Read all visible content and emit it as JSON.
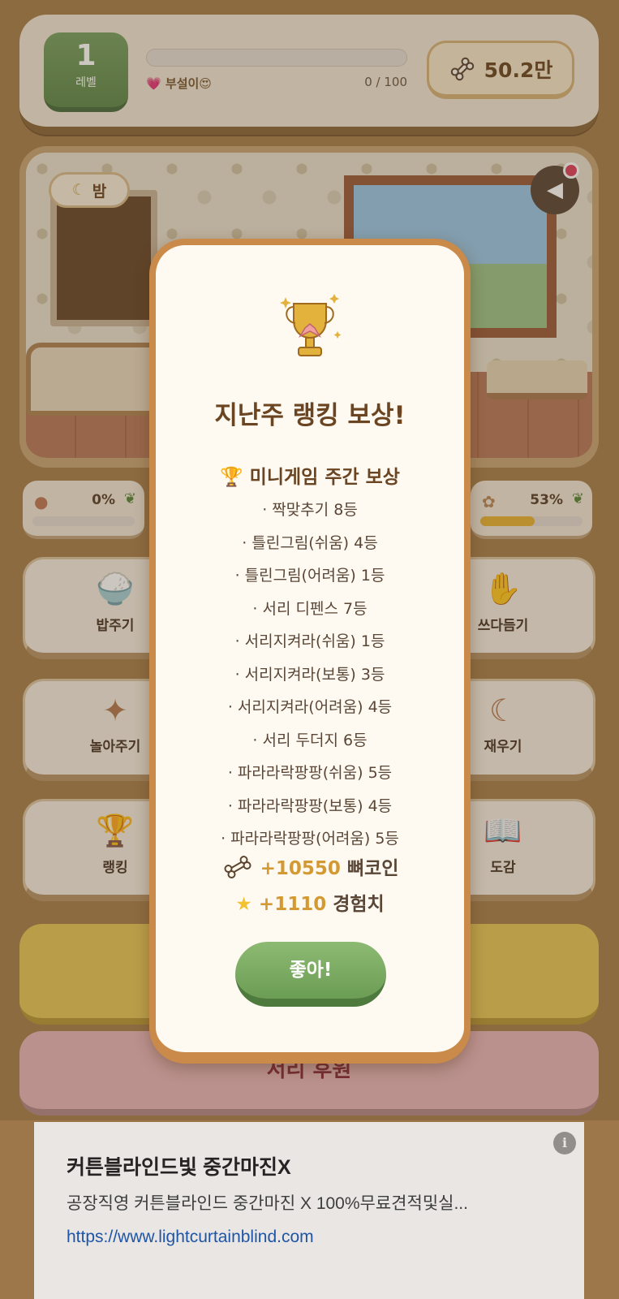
{
  "header": {
    "level": "1",
    "level_label": "레벨",
    "pet_name": "💗 부설이😍",
    "xp_text": "0 / 100",
    "coins": "50.2만"
  },
  "scene": {
    "time_label": "밤"
  },
  "stats": [
    {
      "pct": "0%",
      "fill": 0
    },
    {
      "pct": "53%",
      "fill": 0.53
    }
  ],
  "actions": {
    "feed": "밥주기",
    "pet": "쓰다듬기",
    "play": "놀아주기",
    "sleep": "재우기",
    "ranking": "랭킹",
    "collection": "도감"
  },
  "support_button": "서리 후원",
  "modal": {
    "title": "지난주 랭킹 보상!",
    "section": "미니게임 주간 보상",
    "ranks": [
      "· 짝맞추기 8등",
      "· 틀린그림(쉬움) 4등",
      "· 틀린그림(어려움) 1등",
      "· 서리 디펜스 7등",
      "· 서리지켜라(쉬움) 1등",
      "· 서리지켜라(보통) 3등",
      "· 서리지켜라(어려움) 4등",
      "· 서리 두더지 6등",
      "· 파라라락팡팡(쉬움) 5등",
      "· 파라라락팡팡(보통) 4등",
      "· 파라라락팡팡(어려움) 5등"
    ],
    "coin_reward": {
      "amount": "+10550",
      "unit": "뼈코인"
    },
    "exp_reward": {
      "amount": "+1110",
      "unit": "경험치"
    },
    "ok_label": "좋아!"
  },
  "ad": {
    "title": "커튼블라인드빛 중간마진X",
    "description": "공장직영 커튼블라인드 중간마진 X 100%무료견적및실...",
    "url": "https://www.lightcurtainblind.com",
    "info_icon": "i"
  },
  "colors": {
    "background": "#a9814f",
    "accent_green": "#6c9d55",
    "title_brown": "#6b4522",
    "reward_gold": "#d39a34"
  }
}
